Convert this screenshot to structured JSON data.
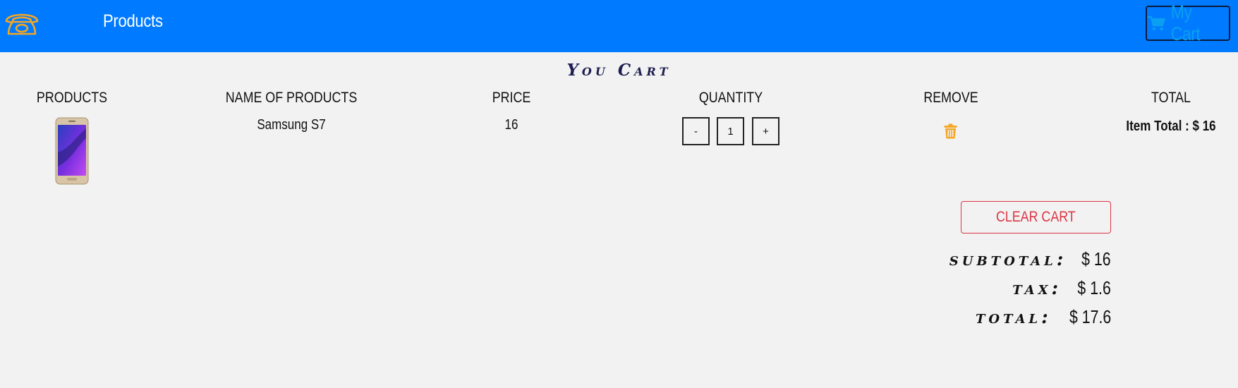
{
  "navbar": {
    "products_label": "Products",
    "cart_label": "My Cart"
  },
  "cart": {
    "title": "You Cart",
    "columns": [
      "PRODUCTS",
      "NAME OF PRODUCTS",
      "PRICE",
      "QUANTITY",
      "REMOVE",
      "TOTAL"
    ],
    "items": [
      {
        "image": "samsung-s7-phone",
        "name": "Samsung S7",
        "price": "16",
        "quantity": "1",
        "decrement": "-",
        "increment": "+",
        "item_total": "Item Total : $ 16"
      }
    ],
    "clear_label": "CLEAR CART",
    "summary": {
      "subtotal_label": "subtotal:",
      "subtotal_value": "$ 16",
      "tax_label": "tax:",
      "tax_value": "$ 1.6",
      "total_label": "total:",
      "total_value": "$ 17.6"
    }
  },
  "colors": {
    "navbar": "#007bff",
    "accent": "#f5a623",
    "danger": "#dc3545",
    "cart_text": "#0a9ff0"
  },
  "icons": {
    "contact": "phone-icon",
    "cart": "shopping-cart-icon",
    "remove": "trash-icon"
  }
}
